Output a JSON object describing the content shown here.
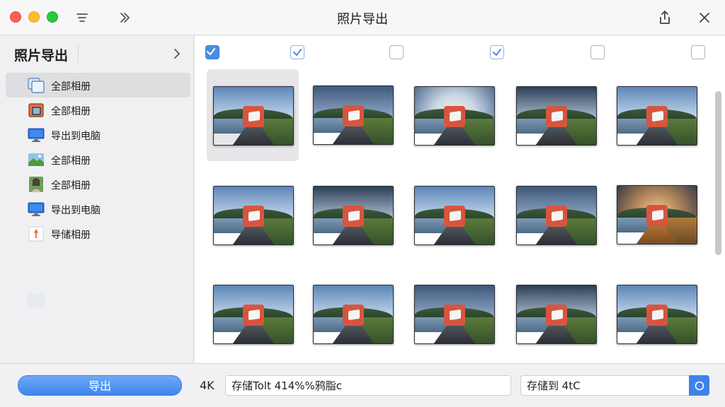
{
  "window": {
    "title": "照片导出"
  },
  "sidebar": {
    "title": "照片导出",
    "items": [
      {
        "label": "全部相册",
        "icon": "album-stack-icon",
        "active": true
      },
      {
        "label": "全部相册",
        "icon": "album-book-icon",
        "active": false
      },
      {
        "label": "导出到电脑",
        "icon": "computer-monitor-icon",
        "active": false
      },
      {
        "label": "全部相册",
        "icon": "landscape-photo-icon",
        "active": false
      },
      {
        "label": "全部相册",
        "icon": "portrait-photo-icon",
        "active": false
      },
      {
        "label": "导出到电脑",
        "icon": "computer-monitor-icon",
        "active": false
      },
      {
        "label": "导储相册",
        "icon": "pin-icon",
        "active": false
      }
    ]
  },
  "grid": {
    "checkboxes": [
      true,
      true,
      false,
      true,
      false,
      false
    ],
    "rows": 3,
    "cols": 5
  },
  "bottombar": {
    "export_label": "导出",
    "resolution": "4K",
    "path_value": "存储Tolt 414%%鸦脂c",
    "dest_value": "存储到 4tC"
  },
  "colors": {
    "accent": "#3f86ee",
    "sidebar_bg": "#f0f0f2",
    "selected_cell": "#e6e6e9"
  }
}
